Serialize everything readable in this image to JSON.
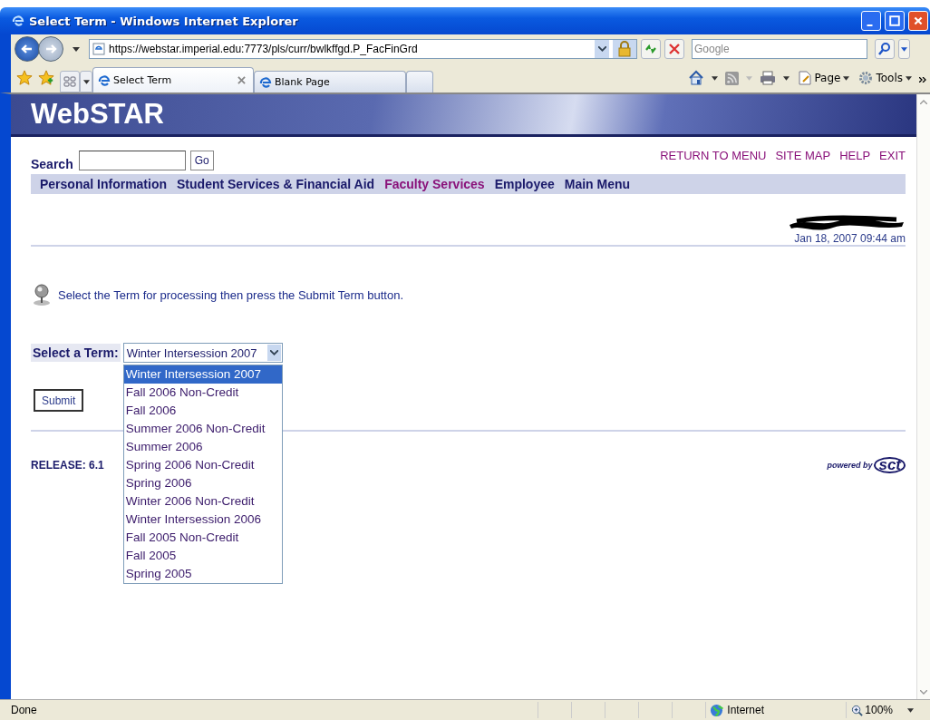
{
  "window": {
    "title": "Select Term - Windows Internet Explorer"
  },
  "address_bar": {
    "url": "https://webstar.imperial.edu:7773/pls/curr/bwlkffgd.P_FacFinGrd"
  },
  "search_box": {
    "placeholder": "Google"
  },
  "tabs": [
    {
      "label": "Select Term",
      "selected": true
    },
    {
      "label": "Blank Page",
      "selected": false
    }
  ],
  "command_bar": [
    "Page",
    "Tools"
  ],
  "banner": {
    "title": "WebSTAR"
  },
  "page": {
    "search_label": "Search",
    "search_button": "Go",
    "top_links": [
      "RETURN TO MENU",
      "SITE MAP",
      "HELP",
      "EXIT"
    ],
    "menu": [
      {
        "label": "Personal Information",
        "selected": false
      },
      {
        "label": "Student Services & Financial Aid",
        "selected": false
      },
      {
        "label": "Faculty Services",
        "selected": true
      },
      {
        "label": "Employee",
        "selected": false
      },
      {
        "label": "Main Menu",
        "selected": false
      }
    ],
    "timestamp": "Jan 18, 2007 09:44 am",
    "info": "Select the Term for processing then press the Submit Term button.",
    "term_label": "Select a Term:",
    "term_value": "Winter Intersession 2007",
    "term_options": [
      {
        "label": "Winter Intersession 2007",
        "selected": true
      },
      {
        "label": "Fall 2006 Non-Credit",
        "selected": false
      },
      {
        "label": "Fall 2006",
        "selected": false
      },
      {
        "label": "Summer 2006 Non-Credit",
        "selected": false
      },
      {
        "label": "Summer 2006",
        "selected": false
      },
      {
        "label": "Spring 2006 Non-Credit",
        "selected": false
      },
      {
        "label": "Spring 2006",
        "selected": false
      },
      {
        "label": "Winter 2006 Non-Credit",
        "selected": false
      },
      {
        "label": "Winter Intersession 2006",
        "selected": false
      },
      {
        "label": "Fall 2005 Non-Credit",
        "selected": false
      },
      {
        "label": "Fall 2005",
        "selected": false
      },
      {
        "label": "Spring 2005",
        "selected": false
      }
    ],
    "submit": "Submit",
    "release": "RELEASE: 6.1",
    "powered_by": "powered by",
    "logo": "sct"
  },
  "status_bar": {
    "status": "Done",
    "zone": "Internet",
    "zoom": "100%"
  }
}
